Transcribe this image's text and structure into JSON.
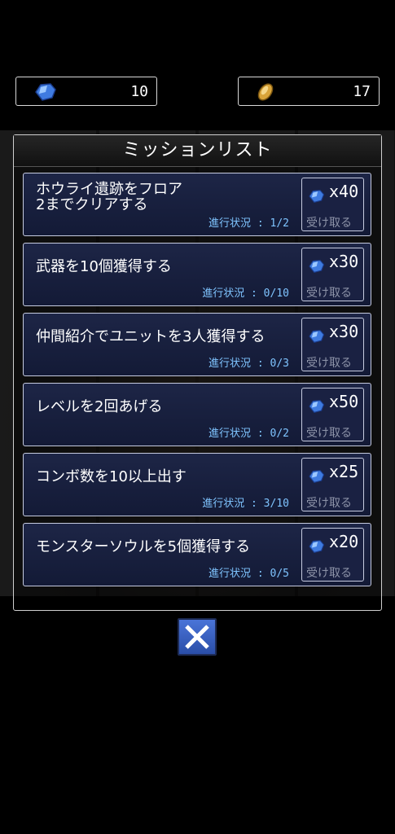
{
  "currencies": [
    {
      "icon": "blue-gem-icon",
      "value": "10"
    },
    {
      "icon": "gold-coin-icon",
      "value": "17"
    }
  ],
  "panel": {
    "title": "ミッションリスト"
  },
  "missions": [
    {
      "title_line1": "ホウライ遺跡をフロア",
      "title_line2": "2までクリアする",
      "progress": "進行状況 : 1/2",
      "reward_icon": "blue-gem-icon",
      "reward": "x40",
      "receive": "受け取る"
    },
    {
      "title_line1": "武器を10個獲得する",
      "title_line2": "",
      "progress": "進行状況 : 0/10",
      "reward_icon": "blue-gem-icon",
      "reward": "x30",
      "receive": "受け取る"
    },
    {
      "title_line1": "仲間紹介でユニットを3人獲得する",
      "title_line2": "",
      "progress": "進行状況 : 0/3",
      "reward_icon": "blue-gem-icon",
      "reward": "x30",
      "receive": "受け取る"
    },
    {
      "title_line1": "レベルを2回あげる",
      "title_line2": "",
      "progress": "進行状況 : 0/2",
      "reward_icon": "blue-gem-icon",
      "reward": "x50",
      "receive": "受け取る"
    },
    {
      "title_line1": "コンボ数を10以上出す",
      "title_line2": "",
      "progress": "進行状況 : 3/10",
      "reward_icon": "blue-gem-icon",
      "reward": "x25",
      "receive": "受け取る"
    },
    {
      "title_line1": "モンスターソウルを5個獲得する",
      "title_line2": "",
      "progress": "進行状況 : 0/5",
      "reward_icon": "blue-gem-icon",
      "reward": "x20",
      "receive": "受け取る"
    }
  ],
  "close": {
    "icon": "close-icon"
  }
}
